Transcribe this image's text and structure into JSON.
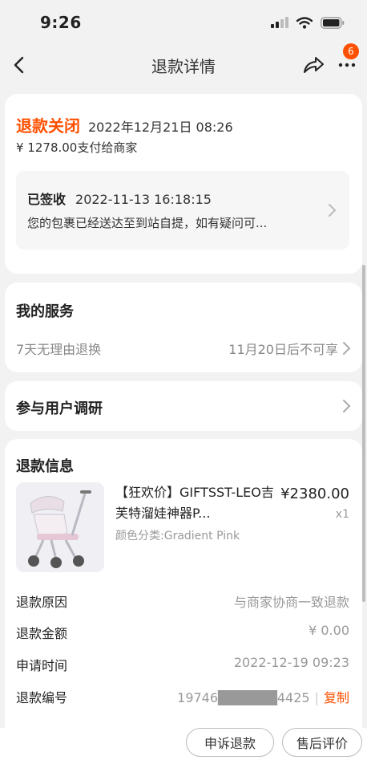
{
  "status_bar": {
    "time": "9:26"
  },
  "nav": {
    "title": "退款详情",
    "badge_count": "6"
  },
  "refund": {
    "status": "退款关闭",
    "time": "2022年12月21日 08:26",
    "paid_line": "¥ 1278.00支付给商家"
  },
  "logistics": {
    "status": "已签收",
    "time": "2022-11-13 16:18:15",
    "desc": "您的包裹已经送达至到站自提，如有疑问可..."
  },
  "service": {
    "title": "我的服务",
    "item_name": "7天无理由退换",
    "item_status": "11月20日后不可享"
  },
  "survey": {
    "title": "参与用户调研"
  },
  "refund_info": {
    "title": "退款信息",
    "product": {
      "title": "【狂欢价】GIFTSST-LEO吉芙特溜娃神器P...",
      "spec": "颜色分类:Gradient Pink",
      "price": "¥2380.00",
      "qty": "x1"
    },
    "rows": [
      {
        "label": "退款原因",
        "value": "与商家协商一致退款"
      },
      {
        "label": "退款金额",
        "value": "¥ 0.00"
      },
      {
        "label": "申请时间",
        "value": "2022-12-19 09:23"
      },
      {
        "label": "退款编号",
        "value": "19746██████4425"
      }
    ],
    "copy_label": "复制"
  },
  "bottom": {
    "apply_label": "申诉退款",
    "review_label": "售后评价"
  },
  "colors": {
    "accent": "#ff5000",
    "muted": "#999999"
  },
  "icons": [
    "back-icon",
    "share-icon",
    "more-icon",
    "chevron-right-icon",
    "signal-icon",
    "wifi-icon",
    "battery-icon"
  ]
}
